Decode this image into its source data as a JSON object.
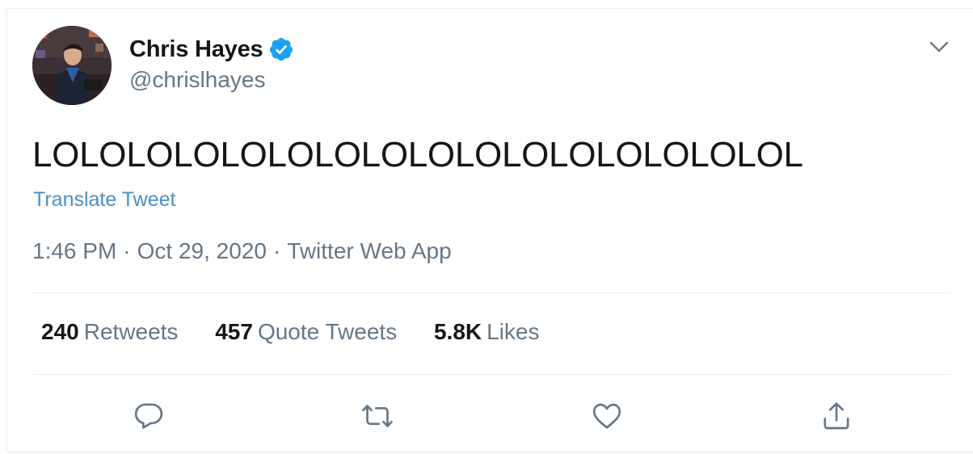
{
  "author": {
    "name": "Chris Hayes",
    "handle": "@chrislhayes",
    "verified": true
  },
  "tweet": {
    "text": "LOLOLOLOLOLOLOLOLOLOLOLOLOLOLOLOL",
    "translate_label": "Translate Tweet",
    "time": "1:46 PM",
    "date": "Oct 29, 2020",
    "source": "Twitter Web App",
    "separator": "·"
  },
  "stats": [
    {
      "count": "240",
      "label": "Retweets"
    },
    {
      "count": "457",
      "label": "Quote Tweets"
    },
    {
      "count": "5.8K",
      "label": "Likes"
    }
  ],
  "actions": [
    "reply-icon",
    "retweet-icon",
    "like-icon",
    "share-icon"
  ],
  "colors": {
    "text_primary": "#14171a",
    "text_secondary": "#657786",
    "link": "#4a90c8",
    "verified_badge": "#1da1f2",
    "divider": "#e6ecf0"
  }
}
